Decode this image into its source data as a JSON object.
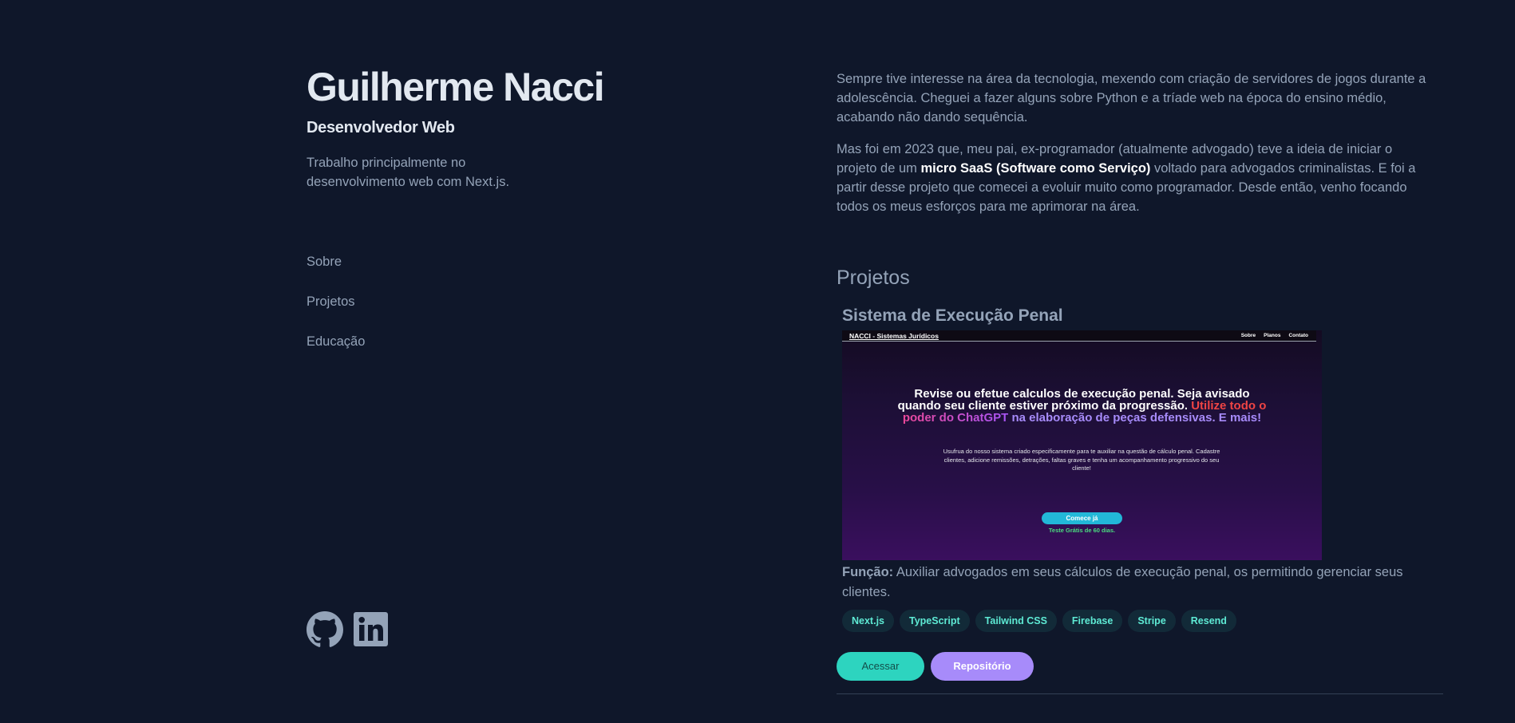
{
  "profile": {
    "name": "Guilherme Nacci",
    "role": "Desenvolvedor Web",
    "bio": "Trabalho principalmente no desenvolvimento web com Next.js."
  },
  "nav": {
    "items": [
      {
        "label": "Sobre"
      },
      {
        "label": "Projetos"
      },
      {
        "label": "Educação"
      }
    ]
  },
  "socials": [
    {
      "icon": "github-icon"
    },
    {
      "icon": "linkedin-icon"
    }
  ],
  "about": {
    "p1": "Sempre tive interesse na área da tecnologia, mexendo com criação de servidores de jogos durante a adolescência. Cheguei a fazer alguns sobre Python e a tríade web na época do ensino médio, acabando não dando sequência.",
    "p2_start": "Mas foi em 2023 que, meu pai, ex-programador (atualmente advogado) teve a ideia de iniciar o projeto de um ",
    "p2_strong": "micro SaaS (Software como Serviço)",
    "p2_end": " voltado para advogados criminalistas. E foi a partir desse projeto que comecei a evoluir muito como programador. Desde então, venho focando todos os meus esforços para me aprimorar na área."
  },
  "projects": {
    "title": "Projetos",
    "items": [
      {
        "name": "Sistema de Execução Penal",
        "screenshot": {
          "brand": "NACCI - Sistemas Jurídicos",
          "links": [
            "Sobre",
            "Planos",
            "Contato"
          ],
          "headline_line1": "Revise ou efetue calculos de execução penal. Seja avisado",
          "headline_line2_white": "quando seu cliente estiver próximo da progressão.",
          "headline_line2_red": " Utilize todo o",
          "headline_line3_pink": "poder do ChatGPT",
          "headline_line3_purple": " na elaboração de peças defensivas. E mais!",
          "subtitle": "Usufrua do nosso sistema criado especificamente para te auxiliar na questão de cálculo penal. Cadastre clientes, adicione remissões, detrações, faltas graves e tenha um acompanhamento progressivo do seu cliente!",
          "cta": "Comece já",
          "trial": "Teste Grátis de 60 dias."
        },
        "function_label": "Função:",
        "function_text": " Auxiliar advogados em seus cálculos de execução penal, os permitindo gerenciar seus clientes.",
        "tags": [
          "Next.js",
          "TypeScript",
          "Tailwind CSS",
          "Firebase",
          "Stripe",
          "Resend"
        ],
        "access_label": "Acessar",
        "repo_label": "Repositório"
      }
    ]
  },
  "colors": {
    "background": "#0f172a",
    "heading": "#e2e8f0",
    "text": "#94a3b8",
    "accent_teal": "#2dd4bf",
    "accent_purple": "#a78bfa"
  }
}
